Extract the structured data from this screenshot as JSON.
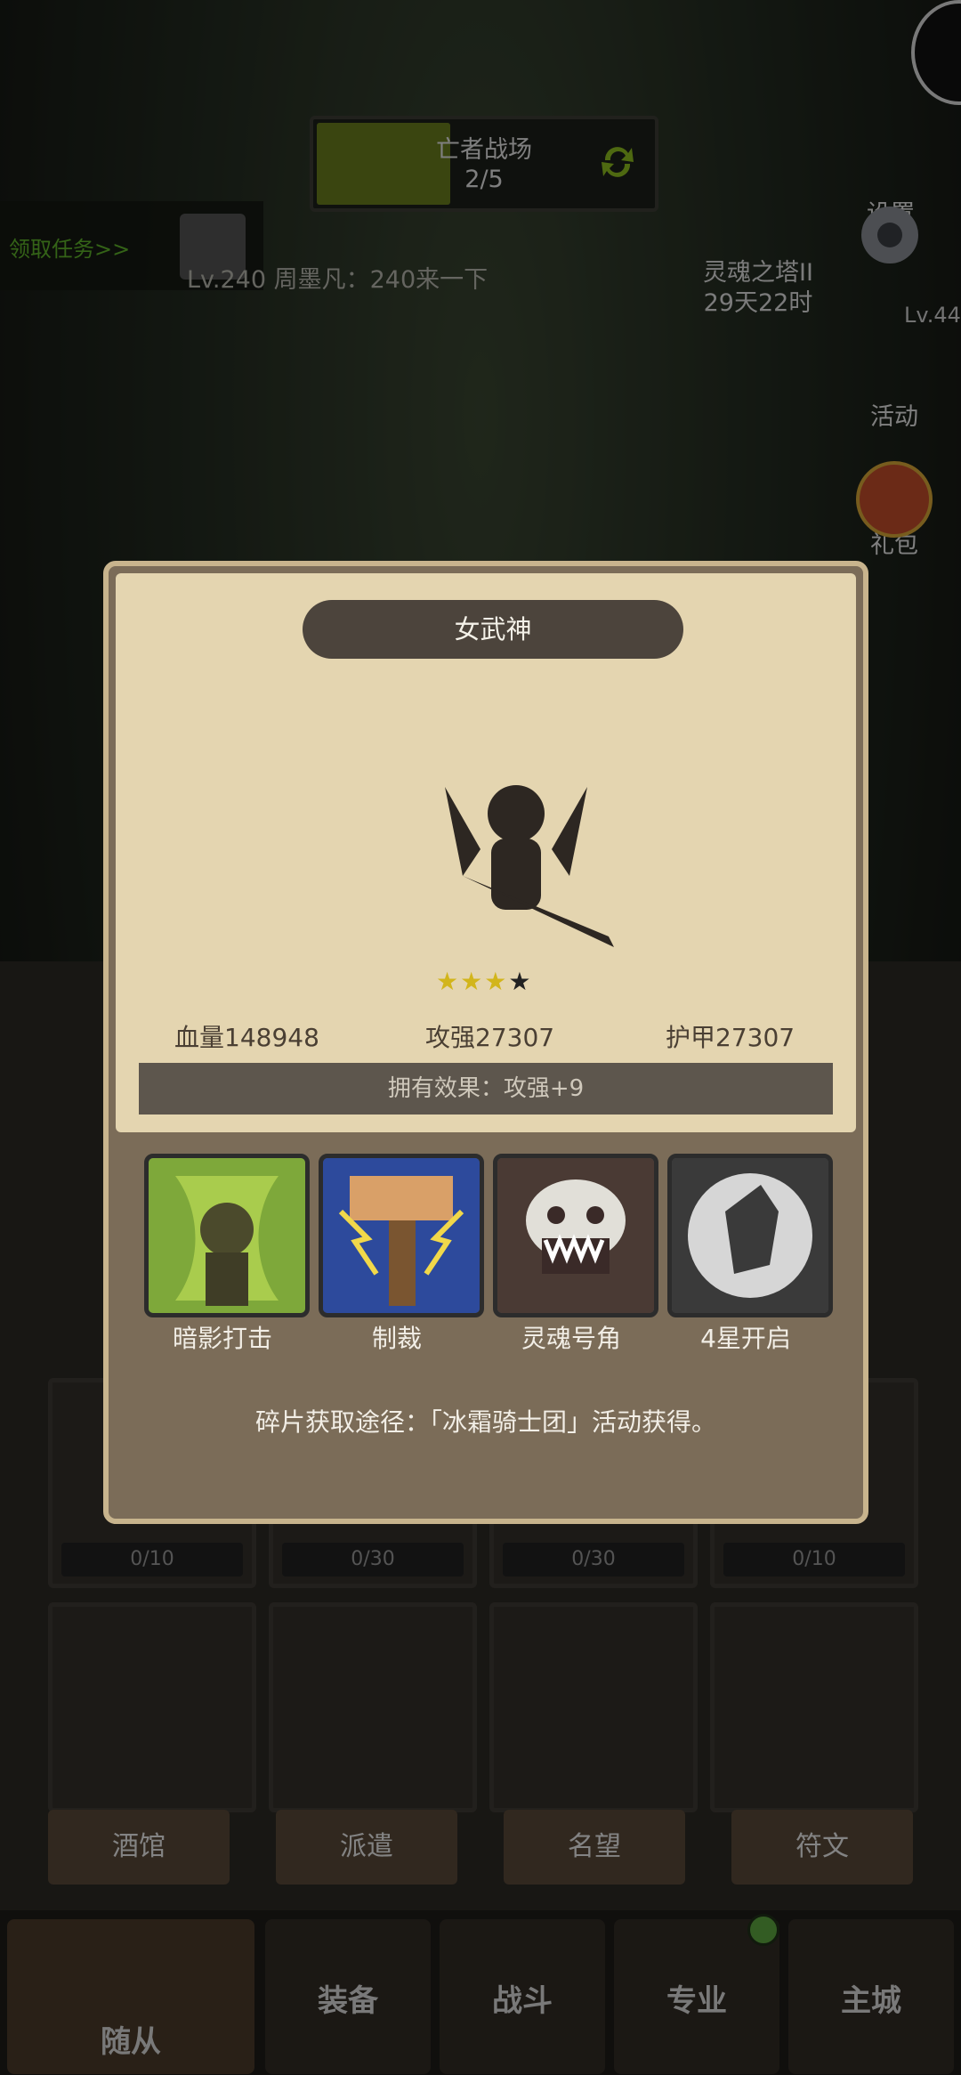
{
  "hud": {
    "quest_title": "亡者战场",
    "quest_progress": "2/5",
    "quest_progress_fraction": 0.4,
    "task_link": "领取任务>>",
    "chat": "Lv.240 周墨凡：240来一下",
    "tower_name": "灵魂之塔II",
    "tower_time": "29天22时",
    "settings": "设置",
    "level": "Lv.44",
    "activity": "活动",
    "gift": "礼包"
  },
  "modal": {
    "title": "女武神",
    "stars_filled": 3,
    "stars_total": 4,
    "stats": {
      "hp": "血量148948",
      "atk": "攻强27307",
      "armor": "护甲27307"
    },
    "effect": "拥有效果：攻强+9",
    "skills": [
      {
        "name": "暗影打击",
        "icon": "shadow-strike-icon"
      },
      {
        "name": "制裁",
        "icon": "hammer-icon"
      },
      {
        "name": "灵魂号角",
        "icon": "skull-horn-icon"
      },
      {
        "name": "4星开启",
        "icon": "locked-fist-icon"
      }
    ],
    "source": "碎片获取途径：「冰霜骑士团」活动获得。"
  },
  "grid": {
    "counts": [
      "0/10",
      "0/30",
      "0/30",
      "0/10"
    ]
  },
  "tabs": [
    "酒馆",
    "派遣",
    "名望",
    "符文"
  ],
  "nav": [
    "随从",
    "装备",
    "战斗",
    "专业",
    "主城"
  ],
  "colors": {
    "parchment": "#e4d5b0",
    "frame": "#7b6c58",
    "star": "#d2b51b",
    "quest_fill": "#6b7f1e"
  }
}
